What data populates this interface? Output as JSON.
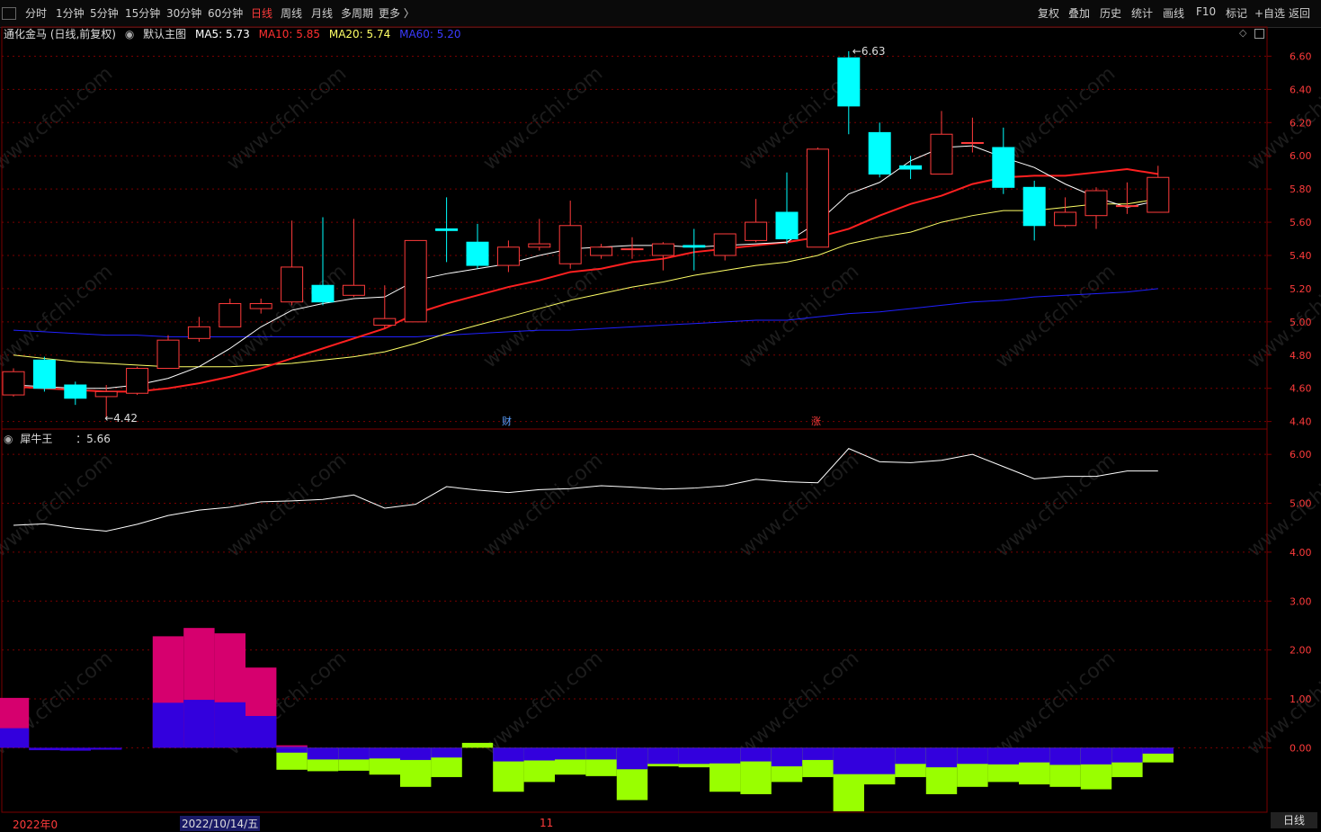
{
  "toolbar": {
    "periods": [
      "分时",
      "1分钟",
      "5分钟",
      "15分钟",
      "30分钟",
      "60分钟",
      "日线",
      "周线",
      "月线",
      "多周期",
      "更多 〉"
    ],
    "active_period": "日线",
    "right_tools": [
      "复权",
      "叠加",
      "历史",
      "统计",
      "画线",
      "F10",
      "标记",
      "+自选",
      "返回"
    ]
  },
  "header": {
    "stock": "通化金马 (日线,前复权)",
    "chart_name": "默认主图",
    "ma5": "MA5: 5.73",
    "ma10": "MA10: 5.85",
    "ma20": "MA20: 5.74",
    "ma60": "MA60: 5.20"
  },
  "colors": {
    "up": "#ff3b3b",
    "down": "#00ffff",
    "ma5": "#ffffff",
    "ma10": "#ff2020",
    "ma20": "#ffff66",
    "ma60": "#2020ff",
    "grid": "#7a0000",
    "bar_magenta": "#d6006e",
    "bar_blue": "#3300dd",
    "bar_green": "#99ff00"
  },
  "chart_data": [
    {
      "type": "candlestick",
      "yaxis_ticks": [
        "6.60",
        "6.40",
        "6.20",
        "6.00",
        "5.80",
        "5.60",
        "5.40",
        "5.20",
        "5.00",
        "4.80",
        "4.60",
        "4.40"
      ],
      "ylim": [
        4.36,
        6.7
      ],
      "annotations": {
        "high": "6.63",
        "low": "4.42",
        "marker_cai": "财",
        "marker_zhang": "涨"
      },
      "candles": [
        {
          "o": 4.56,
          "c": 4.7,
          "h": 4.72,
          "l": 4.55
        },
        {
          "o": 4.77,
          "c": 4.6,
          "h": 4.79,
          "l": 4.58
        },
        {
          "o": 4.62,
          "c": 4.54,
          "h": 4.64,
          "l": 4.5
        },
        {
          "o": 4.55,
          "c": 4.58,
          "h": 4.62,
          "l": 4.42
        },
        {
          "o": 4.57,
          "c": 4.72,
          "h": 4.73,
          "l": 4.56
        },
        {
          "o": 4.72,
          "c": 4.89,
          "h": 4.92,
          "l": 4.72
        },
        {
          "o": 4.9,
          "c": 4.97,
          "h": 5.03,
          "l": 4.88
        },
        {
          "o": 4.97,
          "c": 5.11,
          "h": 5.14,
          "l": 4.97
        },
        {
          "o": 5.08,
          "c": 5.11,
          "h": 5.14,
          "l": 5.05
        },
        {
          "o": 5.12,
          "c": 5.33,
          "h": 5.61,
          "l": 5.1
        },
        {
          "o": 5.22,
          "c": 5.12,
          "h": 5.63,
          "l": 5.1
        },
        {
          "o": 5.16,
          "c": 5.22,
          "h": 5.62,
          "l": 5.15
        },
        {
          "o": 4.98,
          "c": 5.02,
          "h": 5.22,
          "l": 4.96
        },
        {
          "o": 5.0,
          "c": 5.49,
          "h": 5.49,
          "l": 5.0
        },
        {
          "o": 5.56,
          "c": 5.55,
          "h": 5.75,
          "l": 5.36
        },
        {
          "o": 5.48,
          "c": 5.34,
          "h": 5.59,
          "l": 5.32
        },
        {
          "o": 5.34,
          "c": 5.45,
          "h": 5.49,
          "l": 5.3
        },
        {
          "o": 5.45,
          "c": 5.47,
          "h": 5.62,
          "l": 5.43
        },
        {
          "o": 5.35,
          "c": 5.58,
          "h": 5.73,
          "l": 5.32
        },
        {
          "o": 5.4,
          "c": 5.45,
          "h": 5.47,
          "l": 5.38
        },
        {
          "o": 5.44,
          "c": 5.44,
          "h": 5.51,
          "l": 5.38
        },
        {
          "o": 5.4,
          "c": 5.47,
          "h": 5.48,
          "l": 5.31
        },
        {
          "o": 5.46,
          "c": 5.45,
          "h": 5.56,
          "l": 5.31
        },
        {
          "o": 5.4,
          "c": 5.53,
          "h": 5.53,
          "l": 5.37
        },
        {
          "o": 5.49,
          "c": 5.6,
          "h": 5.74,
          "l": 5.48
        },
        {
          "o": 5.66,
          "c": 5.5,
          "h": 5.9,
          "l": 5.47
        },
        {
          "o": 5.45,
          "c": 6.04,
          "h": 6.05,
          "l": 5.45
        },
        {
          "o": 6.59,
          "c": 6.3,
          "h": 6.63,
          "l": 6.13
        },
        {
          "o": 6.14,
          "c": 5.89,
          "h": 6.2,
          "l": 5.87
        },
        {
          "o": 5.94,
          "c": 5.92,
          "h": 6.0,
          "l": 5.86
        },
        {
          "o": 5.89,
          "c": 6.13,
          "h": 6.27,
          "l": 5.89
        },
        {
          "o": 6.08,
          "c": 6.08,
          "h": 6.23,
          "l": 6.02
        },
        {
          "o": 6.05,
          "c": 5.81,
          "h": 6.17,
          "l": 5.77
        },
        {
          "o": 5.81,
          "c": 5.58,
          "h": 5.85,
          "l": 5.49
        },
        {
          "o": 5.58,
          "c": 5.66,
          "h": 5.75,
          "l": 5.57
        },
        {
          "o": 5.64,
          "c": 5.79,
          "h": 5.81,
          "l": 5.56
        },
        {
          "o": 5.7,
          "c": 5.7,
          "h": 5.84,
          "l": 5.65
        },
        {
          "o": 5.66,
          "c": 5.87,
          "h": 5.94,
          "l": 5.66
        }
      ],
      "ma5": [
        4.62,
        4.61,
        4.6,
        4.6,
        4.62,
        4.66,
        4.73,
        4.84,
        4.97,
        5.07,
        5.11,
        5.14,
        5.15,
        5.25,
        5.29,
        5.32,
        5.35,
        5.4,
        5.44,
        5.45,
        5.46,
        5.46,
        5.45,
        5.46,
        5.47,
        5.48,
        5.6,
        5.77,
        5.84,
        5.97,
        6.05,
        6.06,
        5.99,
        5.93,
        5.83,
        5.75,
        5.69,
        5.73
      ],
      "ma10": [
        4.61,
        4.6,
        4.59,
        4.58,
        4.58,
        4.6,
        4.63,
        4.67,
        4.72,
        4.78,
        4.84,
        4.9,
        4.96,
        5.05,
        5.11,
        5.16,
        5.21,
        5.25,
        5.3,
        5.32,
        5.36,
        5.38,
        5.42,
        5.44,
        5.46,
        5.48,
        5.51,
        5.56,
        5.64,
        5.71,
        5.76,
        5.83,
        5.87,
        5.88,
        5.88,
        5.9,
        5.92,
        5.89
      ],
      "ma20": [
        4.8,
        4.78,
        4.76,
        4.75,
        4.74,
        4.73,
        4.73,
        4.73,
        4.74,
        4.75,
        4.77,
        4.79,
        4.82,
        4.87,
        4.93,
        4.98,
        5.03,
        5.08,
        5.13,
        5.17,
        5.21,
        5.24,
        5.28,
        5.31,
        5.34,
        5.36,
        5.4,
        5.47,
        5.51,
        5.54,
        5.6,
        5.64,
        5.67,
        5.67,
        5.69,
        5.71,
        5.71,
        5.74
      ],
      "ma60": [
        4.95,
        4.94,
        4.93,
        4.92,
        4.92,
        4.91,
        4.91,
        4.91,
        4.91,
        4.91,
        4.91,
        4.91,
        4.91,
        4.91,
        4.92,
        4.93,
        4.94,
        4.95,
        4.95,
        4.96,
        4.97,
        4.98,
        4.99,
        5.0,
        5.01,
        5.01,
        5.03,
        5.05,
        5.06,
        5.08,
        5.1,
        5.12,
        5.13,
        5.15,
        5.16,
        5.17,
        5.18,
        5.2
      ]
    },
    {
      "type": "line+bar",
      "name": "犀牛王",
      "value_label": "：5.66",
      "yaxis_ticks": [
        "6.00",
        "5.00",
        "4.00",
        "3.00",
        "2.00",
        "1.00",
        "0.00"
      ],
      "ylim": [
        -1.3,
        6.5
      ],
      "line": [
        4.55,
        4.58,
        4.49,
        4.43,
        4.57,
        4.75,
        4.86,
        4.92,
        5.03,
        5.05,
        5.08,
        5.17,
        4.9,
        4.98,
        5.34,
        5.27,
        5.22,
        5.28,
        5.3,
        5.36,
        5.33,
        5.29,
        5.31,
        5.36,
        5.49,
        5.44,
        5.42,
        6.12,
        5.85,
        5.83,
        5.88,
        6.0,
        5.75,
        5.5,
        5.55,
        5.55,
        5.66,
        5.66
      ],
      "bars_upper_magenta": [
        1.02,
        0,
        0,
        0,
        0,
        2.28,
        2.45,
        2.34,
        1.64,
        0.05,
        0,
        0,
        0,
        0,
        0,
        0,
        0,
        0,
        0,
        0,
        0,
        0,
        0,
        0,
        0,
        0,
        0,
        0,
        0,
        0,
        0,
        0,
        0,
        0,
        0,
        0,
        0,
        0
      ],
      "bars_upper_blue": [
        0.4,
        0,
        0,
        0,
        0,
        0.92,
        0.98,
        0.93,
        0.65,
        0.02,
        0,
        0,
        0,
        0,
        0,
        0,
        0,
        0,
        0,
        0,
        0,
        0,
        0,
        0,
        0,
        0,
        0,
        0,
        0,
        0,
        0,
        0,
        0,
        0,
        0,
        0,
        0,
        0
      ],
      "bars_lower_blue": [
        0,
        -0.05,
        -0.06,
        -0.04,
        0,
        0,
        0,
        0,
        0,
        -0.1,
        -0.24,
        -0.24,
        -0.22,
        -0.25,
        -0.2,
        0.1,
        -0.28,
        -0.26,
        -0.24,
        -0.24,
        -0.44,
        -0.33,
        -0.33,
        -0.32,
        -0.28,
        -0.38,
        -0.25,
        -0.54,
        -0.54,
        -0.33,
        -0.4,
        -0.33,
        -0.34,
        -0.3,
        -0.35,
        -0.34,
        -0.3,
        -0.12
      ],
      "bars_lower_green": [
        0,
        0,
        0,
        0,
        0,
        0,
        0,
        0,
        0,
        -0.45,
        -0.48,
        -0.47,
        -0.55,
        -0.8,
        -0.6,
        0,
        -0.9,
        -0.7,
        -0.55,
        -0.58,
        -1.07,
        -0.38,
        -0.4,
        -0.9,
        -0.95,
        -0.7,
        -0.6,
        -1.3,
        -0.75,
        -0.6,
        -0.95,
        -0.8,
        -0.7,
        -0.75,
        -0.8,
        -0.85,
        -0.6,
        -0.3
      ]
    }
  ],
  "footer": {
    "date_left": "2022年0",
    "date_mid": "2022/10/14/五",
    "date_right": "11",
    "period_button": "日线"
  }
}
